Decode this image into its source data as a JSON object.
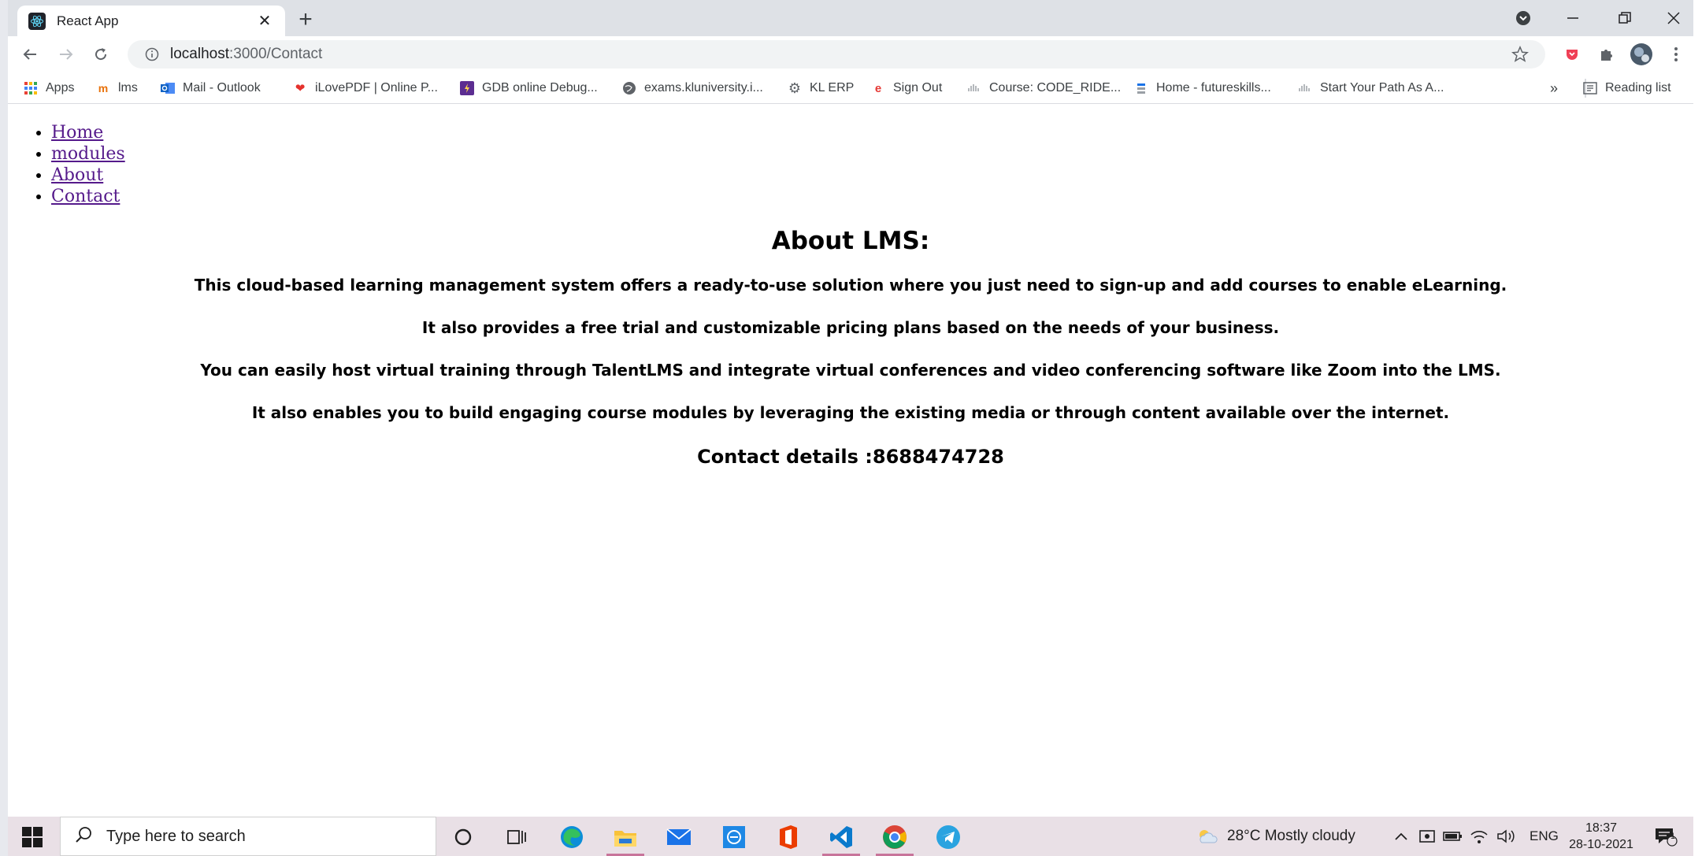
{
  "browser": {
    "tab_title": "React App",
    "tab_close": "✕",
    "new_tab": "+",
    "url_host": "localhost",
    "url_path": ":3000/Contact"
  },
  "bookmarks": [
    {
      "label": "Apps",
      "icon": "apps-grid-icon"
    },
    {
      "label": "lms",
      "icon": "lms-icon"
    },
    {
      "label": "Mail - Outlook",
      "icon": "outlook-icon"
    },
    {
      "label": "iLovePDF | Online P...",
      "icon": "heart-icon"
    },
    {
      "label": "GDB online Debug...",
      "icon": "gdb-icon"
    },
    {
      "label": "exams.kluniversity.i...",
      "icon": "globe-icon"
    },
    {
      "label": "KL ERP",
      "icon": "gear-icon"
    },
    {
      "label": "Sign Out",
      "icon": "signout-icon"
    },
    {
      "label": "Course: CODE_RIDE...",
      "icon": "cisco-icon"
    },
    {
      "label": "Home - futureskills...",
      "icon": "futureskills-icon"
    },
    {
      "label": "Start Your Path As A...",
      "icon": "cisco-icon"
    }
  ],
  "bookmarks_overflow": "»",
  "reading_list": "Reading list",
  "nav": {
    "home": "Home",
    "modules": "modules",
    "about": "About",
    "contact": "Contact"
  },
  "content": {
    "heading": "About LMS:",
    "p1": "This cloud-based learning management system offers a ready-to-use solution where you just need to sign-up and add courses to enable eLearning.",
    "p2": "It also provides a free trial and customizable pricing plans based on the needs of your business.",
    "p3": "You can easily host virtual training through TalentLMS and integrate virtual conferences and video conferencing software like Zoom into the LMS.",
    "p4": "It also enables you to build engaging course modules by leveraging the existing media or through content available over the internet.",
    "contact": "Contact details :8688474728"
  },
  "taskbar": {
    "search_placeholder": "Type here to search",
    "weather": "28°C  Mostly cloudy",
    "lang": "ENG",
    "time": "18:37",
    "date": "28-10-2021",
    "notification_count": "1"
  },
  "colors": {
    "link": "#551a8b",
    "tabstrip": "#dee1e6",
    "taskbar": "#e9e0e6"
  }
}
